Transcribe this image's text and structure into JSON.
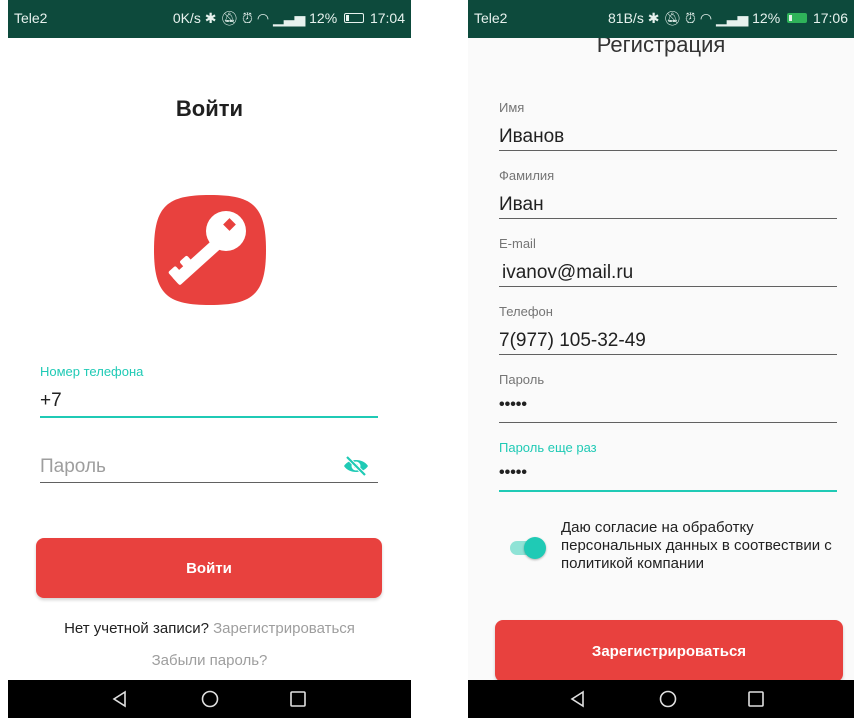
{
  "colors": {
    "accent": "#1fcab5",
    "button": "#e8413e",
    "status_bar": "#0d4a3c"
  },
  "login_screen": {
    "status": {
      "carrier": "Tele2",
      "network": "0K/s",
      "battery_pct": "12%",
      "time": "17:04"
    },
    "title": "Войти",
    "phone_label": "Номер телефона",
    "phone_value": "+7",
    "password_placeholder": "Пароль",
    "submit_label": "Войти",
    "no_account_text": "Нет учетной записи?",
    "register_link": "Зарегистрироваться",
    "forgot_link": "Забыли пароль?",
    "icons": {
      "logo": "key-icon",
      "visibility": "eye-off-icon"
    }
  },
  "register_screen": {
    "status": {
      "carrier": "Tele2",
      "network": "81B/s",
      "battery_pct": "12%",
      "time": "17:06"
    },
    "title": "Регистрация",
    "fields": [
      {
        "label": "Имя",
        "value": "Иванов"
      },
      {
        "label": "Фамилия",
        "value": "Иван"
      },
      {
        "label": "E-mail",
        "value": "ivanov@mail.ru"
      },
      {
        "label": "Телефон",
        "value": "7(977) 105-32-49"
      },
      {
        "label": "Пароль",
        "value": "•••••"
      },
      {
        "label": "Пароль еще раз",
        "value": "•••••"
      }
    ],
    "consent_text": "Даю согласие на обработку персональных данных в соотвествии с политикой компании",
    "consent_enabled": true,
    "submit_label": "Зарегистрироваться"
  },
  "navbar_icons": [
    "back-icon",
    "home-icon",
    "recents-icon"
  ]
}
